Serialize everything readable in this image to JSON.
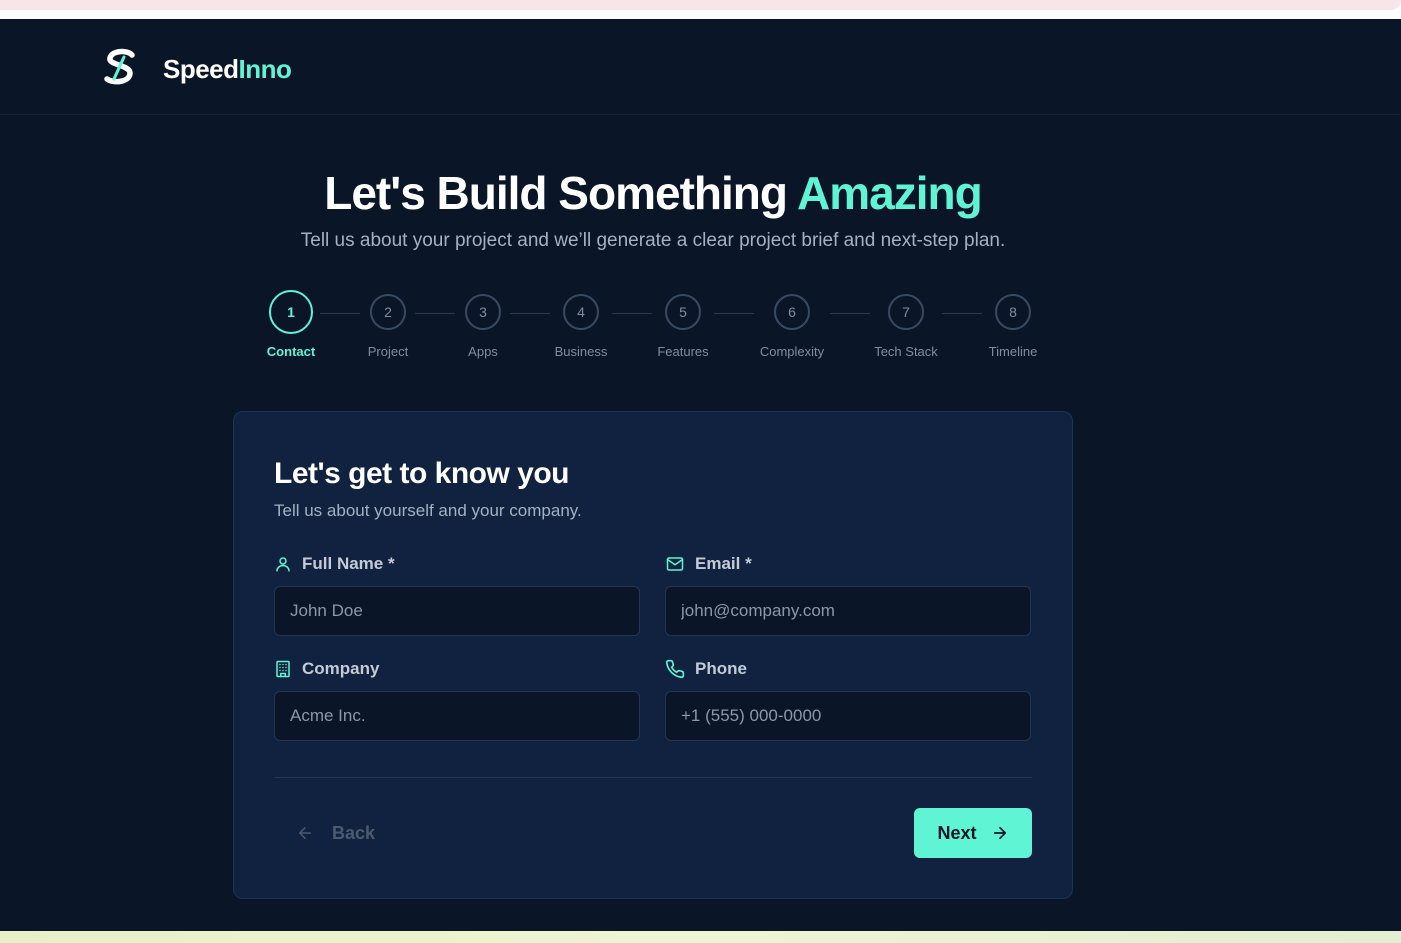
{
  "brand": {
    "name_part1": "Speed",
    "name_part2": "Inno"
  },
  "hero": {
    "title_part1": "Let's Build Something ",
    "title_part2": "Amazing",
    "subtitle": "Tell us about your project and we’ll generate a clear project brief and next-step plan."
  },
  "steps": [
    {
      "num": "1",
      "label": "Contact",
      "active": true
    },
    {
      "num": "2",
      "label": "Project",
      "active": false
    },
    {
      "num": "3",
      "label": "Apps",
      "active": false
    },
    {
      "num": "4",
      "label": "Business",
      "active": false
    },
    {
      "num": "5",
      "label": "Features",
      "active": false
    },
    {
      "num": "6",
      "label": "Complexity",
      "active": false
    },
    {
      "num": "7",
      "label": "Tech Stack",
      "active": false
    },
    {
      "num": "8",
      "label": "Timeline",
      "active": false
    }
  ],
  "form": {
    "title": "Let's get to know you",
    "subtitle": "Tell us about yourself and your company.",
    "full_name": {
      "label": "Full Name *",
      "placeholder": "John Doe",
      "value": "",
      "icon": "user-icon"
    },
    "email": {
      "label": "Email *",
      "placeholder": "john@company.com",
      "value": "",
      "icon": "mail-icon"
    },
    "company": {
      "label": "Company",
      "placeholder": "Acme Inc.",
      "value": "",
      "icon": "building-icon"
    },
    "phone": {
      "label": "Phone",
      "placeholder": "+1 (555) 000-0000",
      "value": "",
      "icon": "phone-icon"
    }
  },
  "nav": {
    "back_label": "Back",
    "next_label": "Next"
  },
  "colors": {
    "background": "#0a1628",
    "card": "#112240",
    "accent": "#5ff5d4",
    "muted_text": "#a4b1c4"
  }
}
